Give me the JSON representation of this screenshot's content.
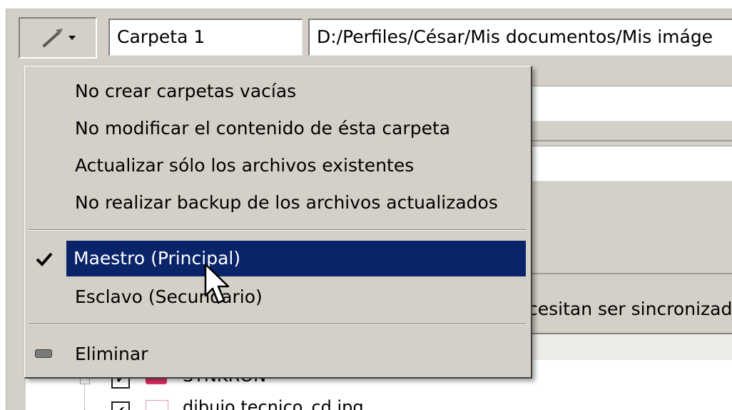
{
  "toolbar": {
    "tools_icon": "wrench-dropdown-icon",
    "folder_name_value": "Carpeta 1",
    "folder_path_value": "D:/Perfiles/César/Mis documentos/Mis imáge"
  },
  "context_menu": {
    "items": [
      {
        "label": "No crear carpetas vacías",
        "checked": false
      },
      {
        "label": "No modificar el contenido de ésta carpeta",
        "checked": false
      },
      {
        "label": "Actualizar sólo los archivos existentes",
        "checked": false
      },
      {
        "label": "No realizar backup de los archivos actualizados",
        "checked": false
      }
    ],
    "mode_items": [
      {
        "label": "Maestro (Principal)",
        "checked": true,
        "selected": true,
        "icon": "checkmark-icon"
      },
      {
        "label": "Esclavo (Secundario)",
        "checked": false,
        "selected": false
      }
    ],
    "remove_item": {
      "label": "Eliminar",
      "icon": "remove-icon"
    },
    "selection_color": "#0a246a"
  },
  "background": {
    "partial_text": "cesitan ser sincronizad",
    "tree_rows": [
      {
        "label": "SYNKRON",
        "checked": true
      },
      {
        "label": "dibujo tecnico_cd.jpg",
        "checked": true
      }
    ]
  }
}
